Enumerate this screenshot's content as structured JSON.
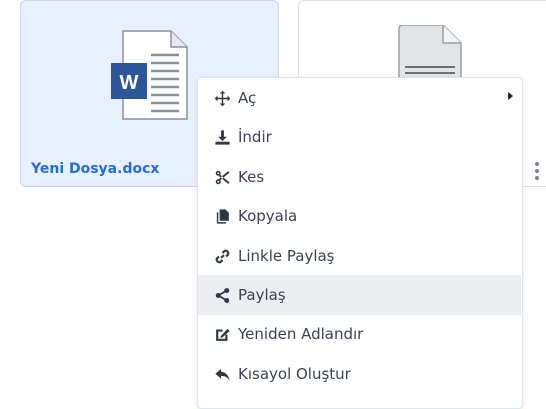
{
  "files": {
    "card1_name": "Yeni Dosya.docx",
    "word_letter": "W"
  },
  "menu": {
    "items": [
      {
        "label": "Aç",
        "icon": "move-icon",
        "submenu": true
      },
      {
        "label": "İndir",
        "icon": "download-icon"
      },
      {
        "label": "Kes",
        "icon": "scissors-icon"
      },
      {
        "label": "Kopyala",
        "icon": "copy-icon"
      },
      {
        "label": "Linkle Paylaş",
        "icon": "link-icon"
      },
      {
        "label": "Paylaş",
        "icon": "share-icon",
        "active": true
      },
      {
        "label": "Yeniden Adlandır",
        "icon": "edit-icon"
      },
      {
        "label": "Kısayol Oluştur",
        "icon": "reply-icon"
      }
    ]
  },
  "colors": {
    "accent": "#1f6fd6",
    "word_blue": "#2b579a",
    "selected_card_bg": "#e8effd",
    "menu_hover": "#ecedf1"
  }
}
